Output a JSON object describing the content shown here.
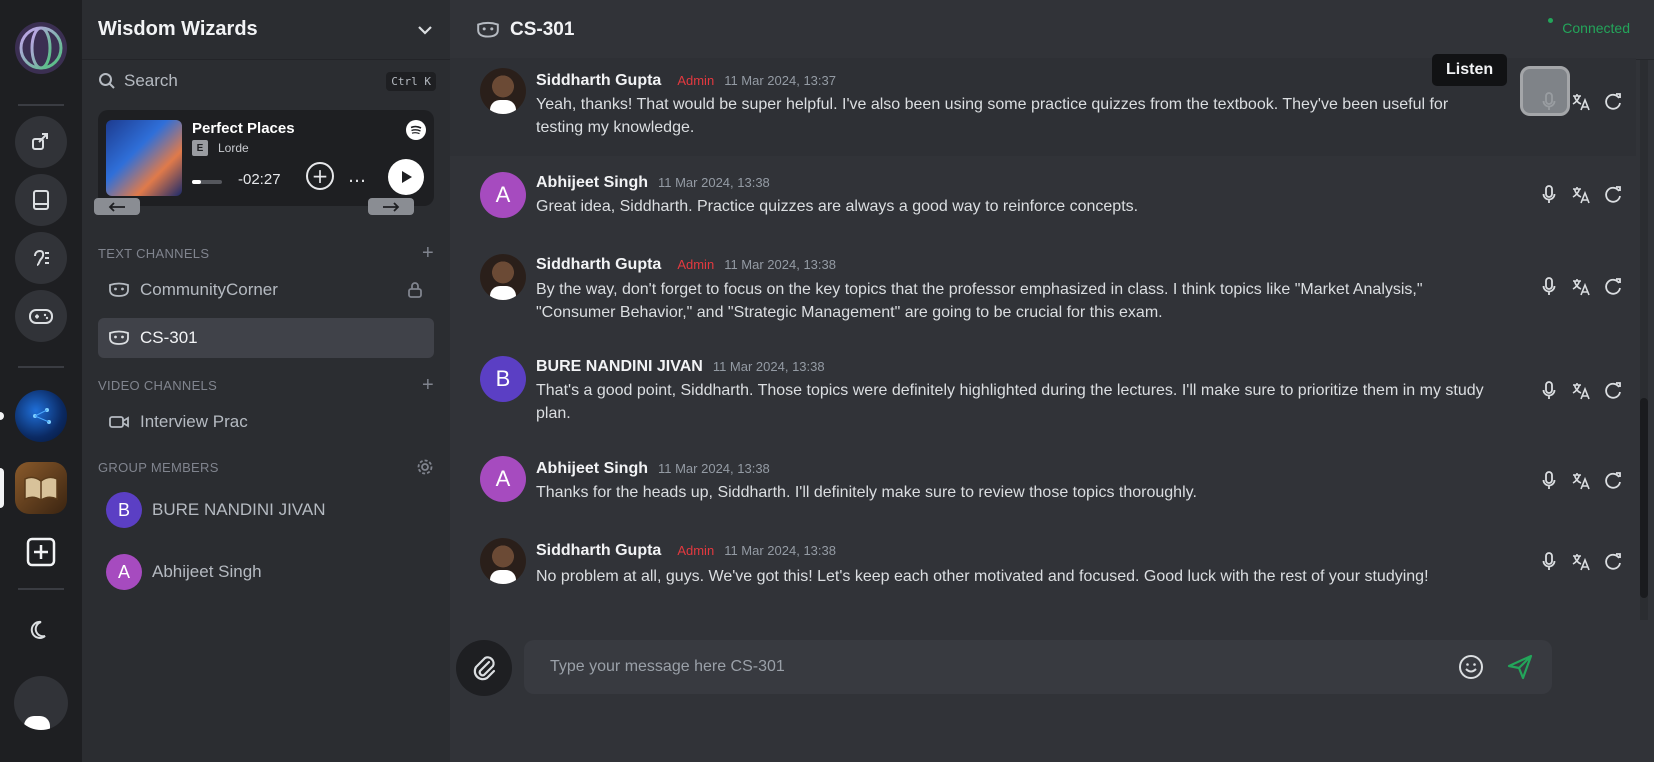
{
  "server": {
    "name": "Wisdom Wizards",
    "search_label": "Search",
    "search_shortcut": "Ctrl K"
  },
  "player": {
    "song": "Perfect Places",
    "explicit_badge": "E",
    "artist": "Lorde",
    "time_remaining": "-02:27",
    "progress": 0.3,
    "more": "…"
  },
  "sections": {
    "text_channels": "TEXT CHANNELS",
    "video_channels": "VIDEO CHANNELS",
    "group_members": "GROUP MEMBERS"
  },
  "channels": {
    "text": [
      {
        "name": "CommunityCorner",
        "locked": true
      },
      {
        "name": "CS-301",
        "active": true
      }
    ],
    "video": [
      {
        "name": "Interview Prac"
      }
    ]
  },
  "members": [
    {
      "initial": "B",
      "name": "BURE NANDINI JIVAN",
      "color": "#5b3fc4"
    },
    {
      "initial": "A",
      "name": "Abhijeet Singh",
      "color": "#a64bbf"
    }
  ],
  "header": {
    "channel": "CS-301",
    "status": "Connected"
  },
  "messages": [
    {
      "author": "Siddharth Gupta",
      "role": "Admin",
      "time": "11 Mar 2024, 13:37",
      "text": "Yeah, thanks! That would be super helpful. I've also been using some practice quizzes from the textbook. They've been useful for testing my knowledge."
    },
    {
      "author": "Abhijeet Singh",
      "initial": "A",
      "time": "11 Mar 2024, 13:38",
      "text": "Great idea, Siddharth. Practice quizzes are always a good way to reinforce concepts."
    },
    {
      "author": "Siddharth Gupta",
      "role": "Admin",
      "time": "11 Mar 2024, 13:38",
      "text": "By the way, don't forget to focus on the key topics that the professor emphasized in class. I think topics like \"Market Analysis,\" \"Consumer Behavior,\" and \"Strategic Management\" are going to be crucial for this exam."
    },
    {
      "author": "BURE NANDINI JIVAN",
      "initial": "B",
      "time": "11 Mar 2024, 13:38",
      "text": "That's a good point, Siddharth. Those topics were definitely highlighted during the lectures. I'll make sure to prioritize them in my study plan."
    },
    {
      "author": "Abhijeet Singh",
      "initial": "A",
      "time": "11 Mar 2024, 13:38",
      "text": "Thanks for the heads up, Siddharth. I'll definitely make sure to review those topics thoroughly."
    },
    {
      "author": "Siddharth Gupta",
      "role": "Admin",
      "time": "11 Mar 2024, 13:38",
      "text": "No problem at all, guys. We've got this! Let's keep each other motivated and focused. Good luck with the rest of your studying!"
    }
  ],
  "tooltip": "Listen",
  "composer": {
    "placeholder": "Type your message here CS-301"
  },
  "colors": {
    "accent_green": "#23a55a",
    "admin_red": "#e2393f",
    "avatar_purple_a": "#a64bbf",
    "avatar_purple_b": "#5b3fc4"
  }
}
